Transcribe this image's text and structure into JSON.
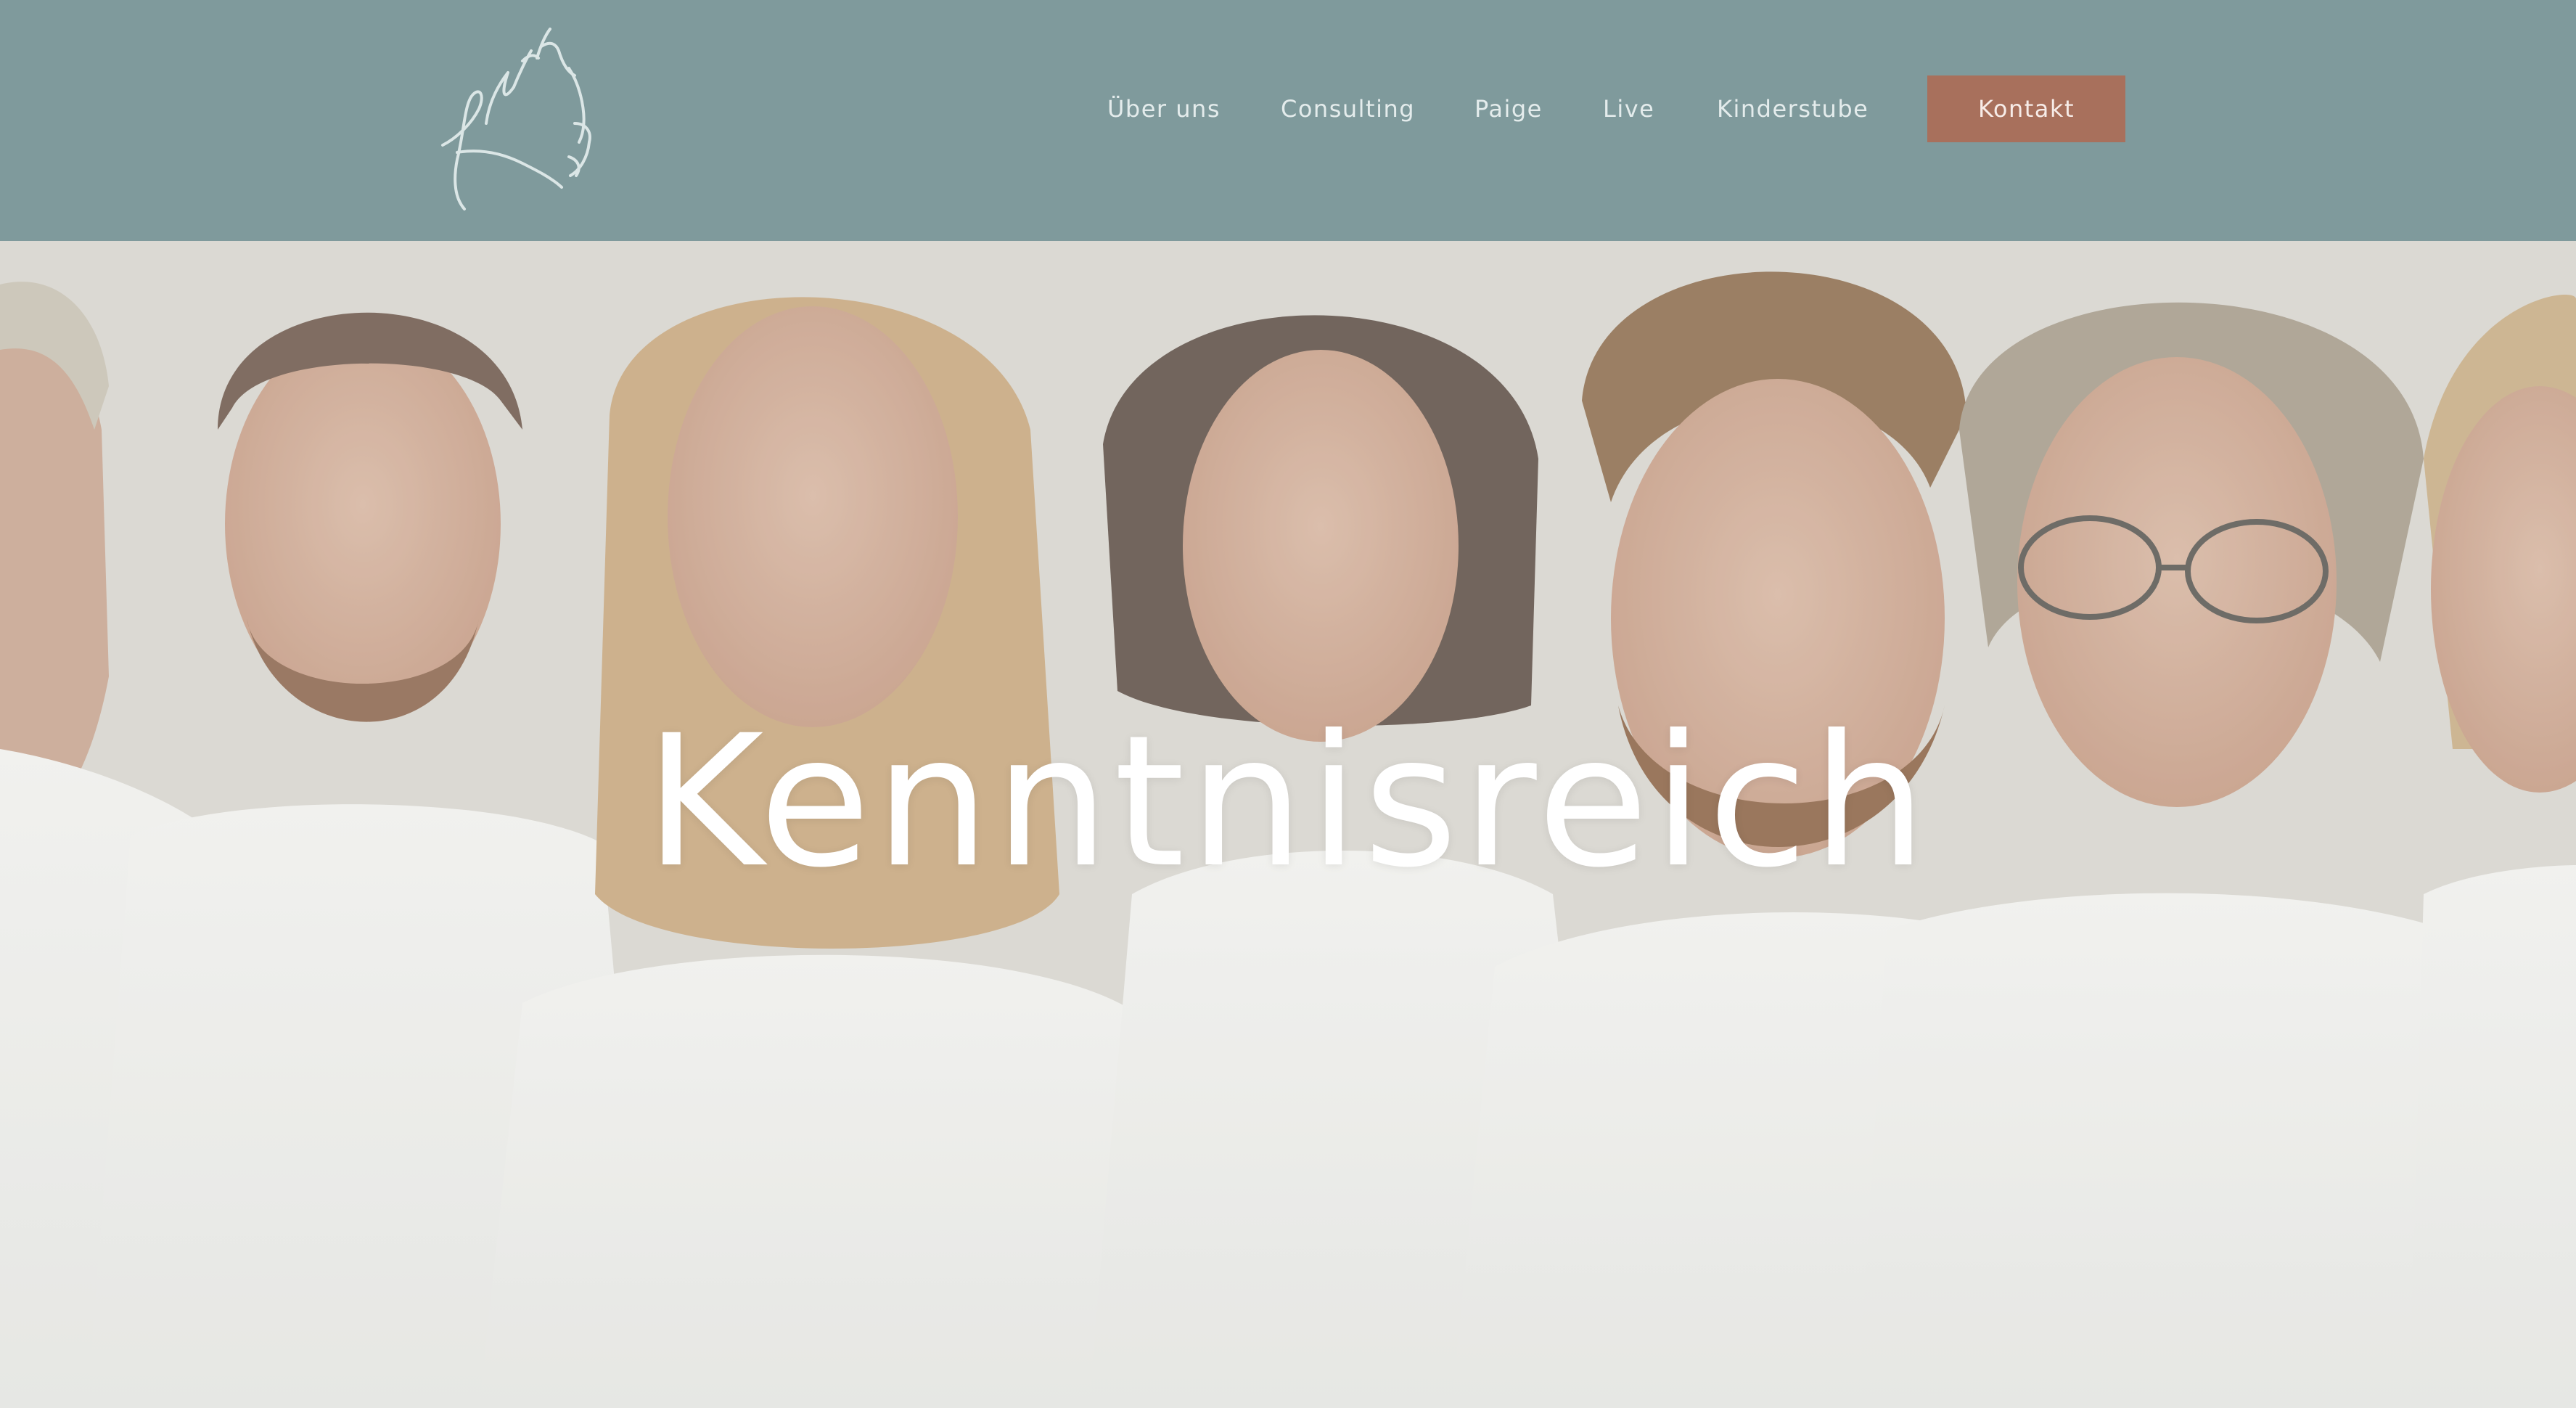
{
  "header": {
    "logo_alt": "Kenntnisreich",
    "nav": [
      {
        "label": "Über uns"
      },
      {
        "label": "Consulting"
      },
      {
        "label": "Paige"
      },
      {
        "label": "Live"
      },
      {
        "label": "Kinderstube"
      }
    ],
    "cta_label": "Kontakt",
    "colors": {
      "header_bg": "#7f9a9c",
      "cta_bg": "#a8705c"
    }
  },
  "hero": {
    "title": "Kenntnisreich",
    "image": "team-portrait-photo"
  }
}
